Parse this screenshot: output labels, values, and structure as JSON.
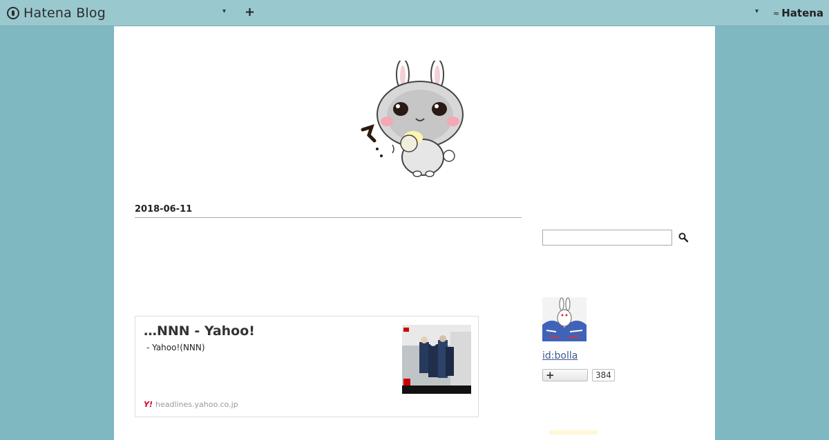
{
  "topbar": {
    "brand": "Hatena Blog",
    "dropdown_icon": "caret-down-icon",
    "add_icon": "plus-icon",
    "hatena_label": "Hatena"
  },
  "post": {
    "date": "2018-06-11"
  },
  "embed_card": {
    "title": "…NNN - Yahoo!",
    "description": "- Yahoo!(NNN)",
    "site": "headlines.yahoo.co.jp",
    "site_icon": "Y!"
  },
  "sidebar": {
    "search_placeholder": "",
    "user_id": "id:bolla",
    "follow_label": "+",
    "follower_count": "384"
  },
  "colors": {
    "page_background": "#7fb8c1",
    "topbar_background": "#9ac8cf",
    "link": "#3a5a8a"
  }
}
